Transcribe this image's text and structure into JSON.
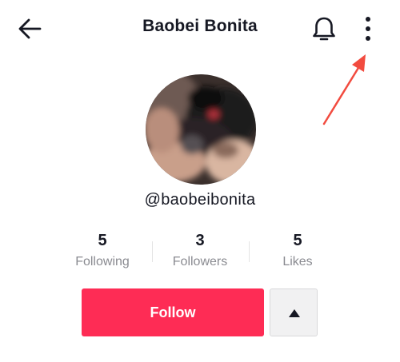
{
  "header": {
    "title": "Baobei Bonita",
    "back_icon": "arrow-left-icon",
    "bell_icon": "bell-icon",
    "more_icon": "more-vertical-icon"
  },
  "profile": {
    "username": "@baobeibonita"
  },
  "stats": [
    {
      "value": "5",
      "label": "Following"
    },
    {
      "value": "3",
      "label": "Followers"
    },
    {
      "value": "5",
      "label": "Likes"
    }
  ],
  "actions": {
    "follow_label": "Follow",
    "toggle_icon": "caret-up-icon"
  },
  "colors": {
    "accent": "#fe2c55",
    "annotation": "#f24b3f",
    "text_primary": "#161823",
    "text_secondary": "#8a8b91"
  }
}
